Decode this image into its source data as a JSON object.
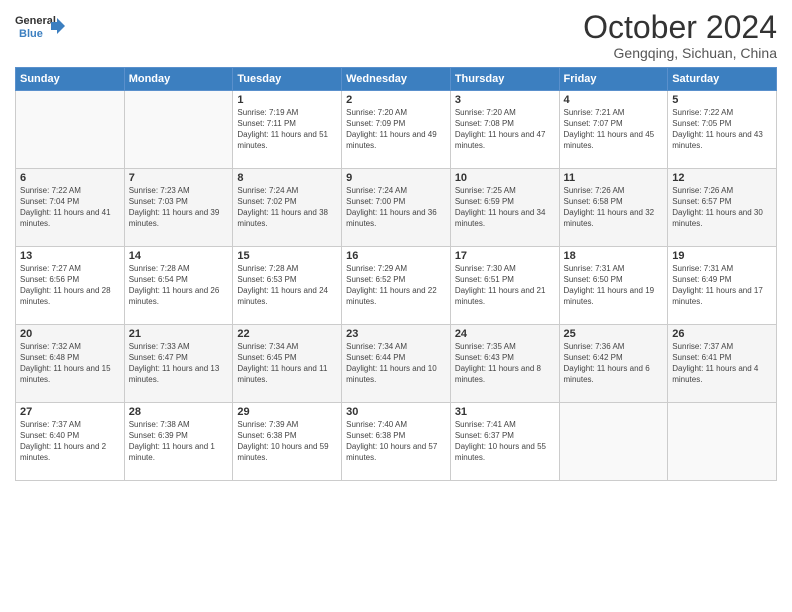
{
  "header": {
    "logo_line1": "General",
    "logo_line2": "Blue",
    "month": "October 2024",
    "location": "Gengqing, Sichuan, China"
  },
  "weekdays": [
    "Sunday",
    "Monday",
    "Tuesday",
    "Wednesday",
    "Thursday",
    "Friday",
    "Saturday"
  ],
  "weeks": [
    [
      {
        "day": "",
        "info": ""
      },
      {
        "day": "",
        "info": ""
      },
      {
        "day": "1",
        "info": "Sunrise: 7:19 AM\nSunset: 7:11 PM\nDaylight: 11 hours and 51 minutes."
      },
      {
        "day": "2",
        "info": "Sunrise: 7:20 AM\nSunset: 7:09 PM\nDaylight: 11 hours and 49 minutes."
      },
      {
        "day": "3",
        "info": "Sunrise: 7:20 AM\nSunset: 7:08 PM\nDaylight: 11 hours and 47 minutes."
      },
      {
        "day": "4",
        "info": "Sunrise: 7:21 AM\nSunset: 7:07 PM\nDaylight: 11 hours and 45 minutes."
      },
      {
        "day": "5",
        "info": "Sunrise: 7:22 AM\nSunset: 7:05 PM\nDaylight: 11 hours and 43 minutes."
      }
    ],
    [
      {
        "day": "6",
        "info": "Sunrise: 7:22 AM\nSunset: 7:04 PM\nDaylight: 11 hours and 41 minutes."
      },
      {
        "day": "7",
        "info": "Sunrise: 7:23 AM\nSunset: 7:03 PM\nDaylight: 11 hours and 39 minutes."
      },
      {
        "day": "8",
        "info": "Sunrise: 7:24 AM\nSunset: 7:02 PM\nDaylight: 11 hours and 38 minutes."
      },
      {
        "day": "9",
        "info": "Sunrise: 7:24 AM\nSunset: 7:00 PM\nDaylight: 11 hours and 36 minutes."
      },
      {
        "day": "10",
        "info": "Sunrise: 7:25 AM\nSunset: 6:59 PM\nDaylight: 11 hours and 34 minutes."
      },
      {
        "day": "11",
        "info": "Sunrise: 7:26 AM\nSunset: 6:58 PM\nDaylight: 11 hours and 32 minutes."
      },
      {
        "day": "12",
        "info": "Sunrise: 7:26 AM\nSunset: 6:57 PM\nDaylight: 11 hours and 30 minutes."
      }
    ],
    [
      {
        "day": "13",
        "info": "Sunrise: 7:27 AM\nSunset: 6:56 PM\nDaylight: 11 hours and 28 minutes."
      },
      {
        "day": "14",
        "info": "Sunrise: 7:28 AM\nSunset: 6:54 PM\nDaylight: 11 hours and 26 minutes."
      },
      {
        "day": "15",
        "info": "Sunrise: 7:28 AM\nSunset: 6:53 PM\nDaylight: 11 hours and 24 minutes."
      },
      {
        "day": "16",
        "info": "Sunrise: 7:29 AM\nSunset: 6:52 PM\nDaylight: 11 hours and 22 minutes."
      },
      {
        "day": "17",
        "info": "Sunrise: 7:30 AM\nSunset: 6:51 PM\nDaylight: 11 hours and 21 minutes."
      },
      {
        "day": "18",
        "info": "Sunrise: 7:31 AM\nSunset: 6:50 PM\nDaylight: 11 hours and 19 minutes."
      },
      {
        "day": "19",
        "info": "Sunrise: 7:31 AM\nSunset: 6:49 PM\nDaylight: 11 hours and 17 minutes."
      }
    ],
    [
      {
        "day": "20",
        "info": "Sunrise: 7:32 AM\nSunset: 6:48 PM\nDaylight: 11 hours and 15 minutes."
      },
      {
        "day": "21",
        "info": "Sunrise: 7:33 AM\nSunset: 6:47 PM\nDaylight: 11 hours and 13 minutes."
      },
      {
        "day": "22",
        "info": "Sunrise: 7:34 AM\nSunset: 6:45 PM\nDaylight: 11 hours and 11 minutes."
      },
      {
        "day": "23",
        "info": "Sunrise: 7:34 AM\nSunset: 6:44 PM\nDaylight: 11 hours and 10 minutes."
      },
      {
        "day": "24",
        "info": "Sunrise: 7:35 AM\nSunset: 6:43 PM\nDaylight: 11 hours and 8 minutes."
      },
      {
        "day": "25",
        "info": "Sunrise: 7:36 AM\nSunset: 6:42 PM\nDaylight: 11 hours and 6 minutes."
      },
      {
        "day": "26",
        "info": "Sunrise: 7:37 AM\nSunset: 6:41 PM\nDaylight: 11 hours and 4 minutes."
      }
    ],
    [
      {
        "day": "27",
        "info": "Sunrise: 7:37 AM\nSunset: 6:40 PM\nDaylight: 11 hours and 2 minutes."
      },
      {
        "day": "28",
        "info": "Sunrise: 7:38 AM\nSunset: 6:39 PM\nDaylight: 11 hours and 1 minute."
      },
      {
        "day": "29",
        "info": "Sunrise: 7:39 AM\nSunset: 6:38 PM\nDaylight: 10 hours and 59 minutes."
      },
      {
        "day": "30",
        "info": "Sunrise: 7:40 AM\nSunset: 6:38 PM\nDaylight: 10 hours and 57 minutes."
      },
      {
        "day": "31",
        "info": "Sunrise: 7:41 AM\nSunset: 6:37 PM\nDaylight: 10 hours and 55 minutes."
      },
      {
        "day": "",
        "info": ""
      },
      {
        "day": "",
        "info": ""
      }
    ]
  ]
}
